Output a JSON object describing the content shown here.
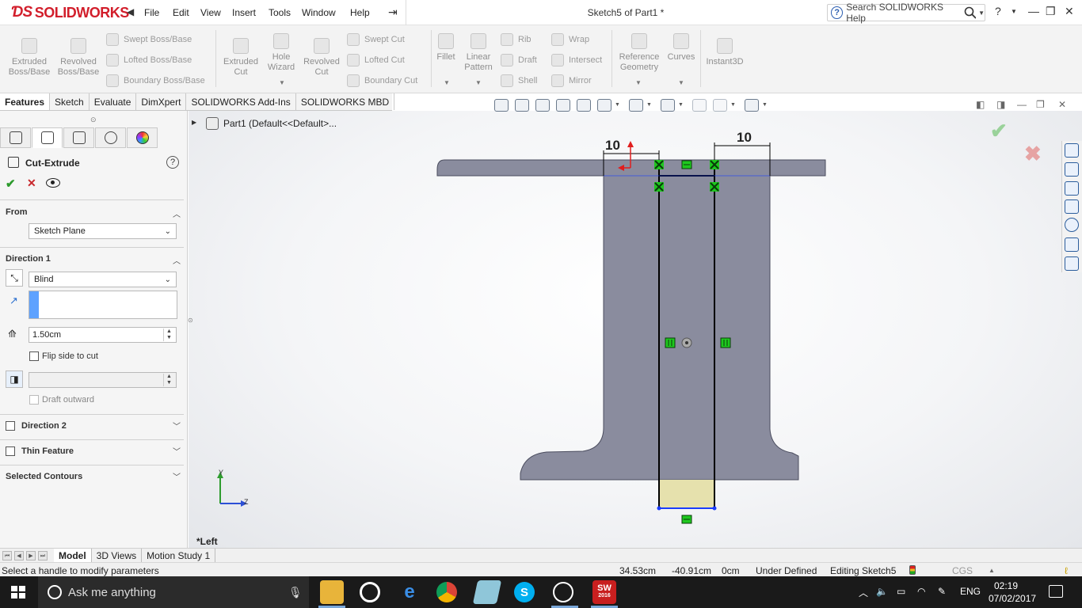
{
  "app": {
    "brand": "SOLIDWORKS",
    "window_title": "Sketch5 of Part1 *"
  },
  "menu": [
    "File",
    "Edit",
    "View",
    "Insert",
    "Tools",
    "Window",
    "Help"
  ],
  "search": {
    "label": "Search SOLIDWORKS Help"
  },
  "toolbar": {
    "extruded_boss": "Extruded Boss/Base",
    "revolved_boss": "Revolved Boss/Base",
    "swept_boss": "Swept Boss/Base",
    "lofted_boss": "Lofted Boss/Base",
    "boundary_boss": "Boundary Boss/Base",
    "extruded_cut": "Extruded Cut",
    "hole_wizard": "Hole Wizard",
    "revolved_cut": "Revolved Cut",
    "swept_cut": "Swept Cut",
    "lofted_cut": "Lofted Cut",
    "boundary_cut": "Boundary Cut",
    "fillet": "Fillet",
    "linear_pattern": "Linear Pattern",
    "rib": "Rib",
    "draft": "Draft",
    "shell": "Shell",
    "wrap": "Wrap",
    "intersect": "Intersect",
    "mirror": "Mirror",
    "reference_geometry": "Reference Geometry",
    "curves": "Curves",
    "instant3d": "Instant3D"
  },
  "tabs": [
    "Features",
    "Sketch",
    "Evaluate",
    "DimXpert",
    "SOLIDWORKS Add-Ins",
    "SOLIDWORKS MBD"
  ],
  "property_manager": {
    "title": "Cut-Extrude",
    "from_label": "From",
    "from_value": "Sketch Plane",
    "direction1_label": "Direction 1",
    "end_condition": "Blind",
    "depth": "1.50cm",
    "flip_side": "Flip side to cut",
    "draft_outward": "Draft outward",
    "direction2_label": "Direction 2",
    "thin_feature_label": "Thin Feature",
    "selected_contours_label": "Selected Contours"
  },
  "tree": {
    "root": "Part1  (Default<<Default>..."
  },
  "graphics": {
    "dim_left": "10",
    "dim_right": "10",
    "view_name": "*Left",
    "axis_y": "Y",
    "axis_z": "Z",
    "part_fill": "#8a8c9e",
    "cut_fill": "#e6e1ad",
    "sketch_point_color": "#1ec81e"
  },
  "bottom_tabs": [
    "Model",
    "3D Views",
    "Motion Study 1"
  ],
  "status": {
    "message": "Select a handle to modify parameters",
    "x": "34.53cm",
    "y": "-40.91cm",
    "z": "0cm",
    "state": "Under Defined",
    "editing": "Editing Sketch5",
    "units": "CGS"
  },
  "taskbar": {
    "search_placeholder": "Ask me anything",
    "language": "ENG",
    "time": "02:19",
    "date": "07/02/2017",
    "sw_badge": "SW",
    "sw_year": "2016"
  }
}
